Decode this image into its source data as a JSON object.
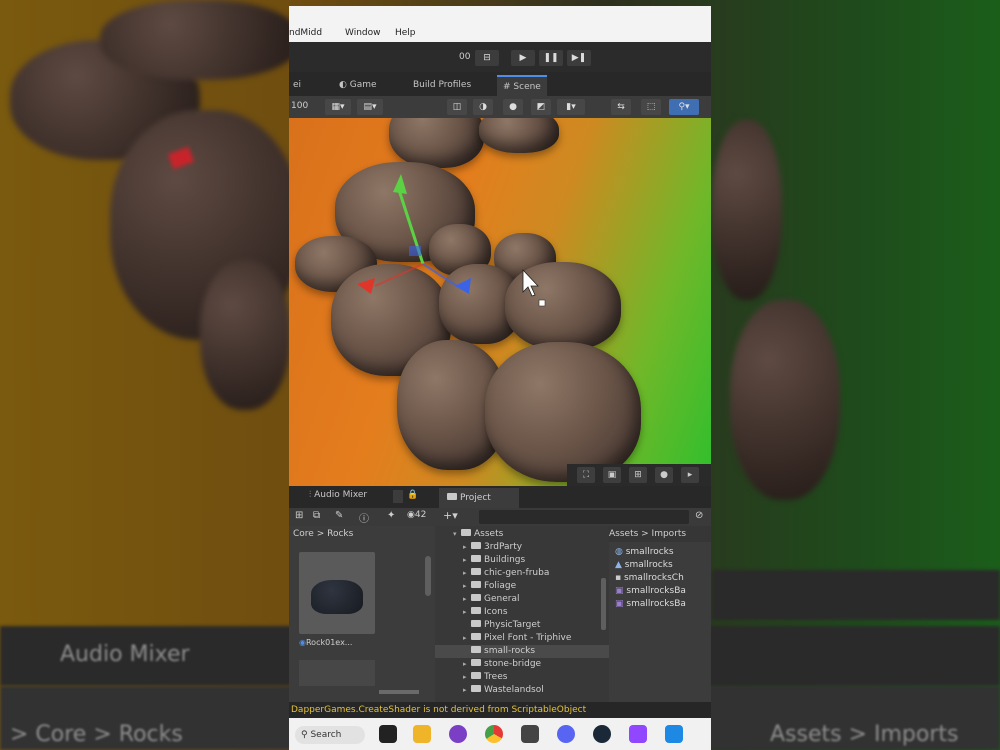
{
  "menu": {
    "items": [
      "Window",
      "Help"
    ],
    "partial_left": "ndMidd"
  },
  "toolbar": {
    "left_label": "00",
    "play": "▶",
    "pause": "❚❚",
    "step": "▶❚"
  },
  "tabs": [
    {
      "label": "ei"
    },
    {
      "label": "Game"
    },
    {
      "label": "Build Profiles"
    },
    {
      "label": "Scene",
      "active": true
    }
  ],
  "scene_toolbar": {
    "left_label": "100"
  },
  "bottom_tabs": {
    "left": "Audio Mixer",
    "right": "Project",
    "count": "42"
  },
  "left_breadcrumb": {
    "prefix": "Core",
    "current": "Rocks"
  },
  "left_item_label": "Rock01ex...",
  "tree": [
    {
      "label": "Assets",
      "root": true
    },
    {
      "label": "3rdParty"
    },
    {
      "label": "Buildings"
    },
    {
      "label": "chic-gen-fruba"
    },
    {
      "label": "Foliage"
    },
    {
      "label": "General"
    },
    {
      "label": "Icons"
    },
    {
      "label": "PhysicTarget"
    },
    {
      "label": "Pixel Font - Triphive"
    },
    {
      "label": "small-rocks",
      "selected": true
    },
    {
      "label": "stone-bridge"
    },
    {
      "label": "Trees"
    },
    {
      "label": "Wastelandsol"
    }
  ],
  "asset_breadcrumb": "Assets > Imports",
  "assets": [
    {
      "label": "smallrocks"
    },
    {
      "label": "smallrocks"
    },
    {
      "label": "smallrocksCh"
    },
    {
      "label": "smallrocksBa"
    },
    {
      "label": "smallrocksBa"
    }
  ],
  "status_message": "DapperGames.CreateShader is not derived from ScriptableObject",
  "taskbar": {
    "search_label": "Search"
  },
  "background": {
    "audio_mixer": "Audio Mixer",
    "breadcrumb": "> Core > Rocks",
    "assets_breadcrumb": "Assets > Imports"
  },
  "colors": {
    "accent": "#4f8ee8",
    "status_warning": "#e3c33a",
    "gizmo_x": "#e0352b",
    "gizmo_y": "#5ad243",
    "gizmo_z": "#3b63e8"
  }
}
